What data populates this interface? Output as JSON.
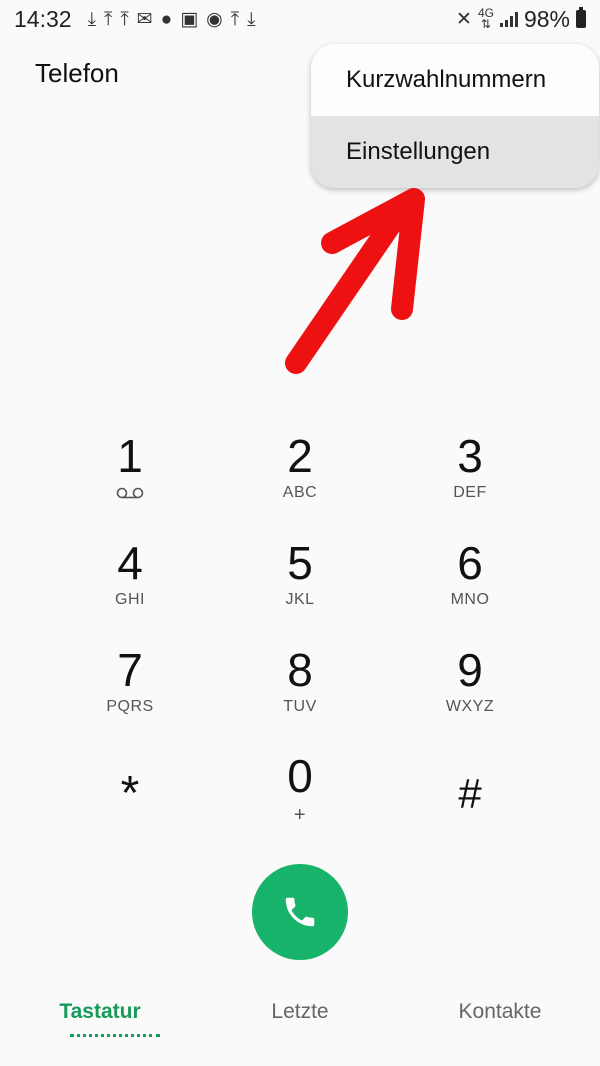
{
  "status_bar": {
    "time": "14:32",
    "network": "4G",
    "battery": "98%"
  },
  "header": {
    "title": "Telefon"
  },
  "menu": {
    "items": [
      {
        "label": "Kurzwahlnummern"
      },
      {
        "label": "Einstellungen"
      }
    ]
  },
  "keypad": {
    "keys": [
      {
        "digit": "1",
        "letters": ""
      },
      {
        "digit": "2",
        "letters": "ABC"
      },
      {
        "digit": "3",
        "letters": "DEF"
      },
      {
        "digit": "4",
        "letters": "GHI"
      },
      {
        "digit": "5",
        "letters": "JKL"
      },
      {
        "digit": "6",
        "letters": "MNO"
      },
      {
        "digit": "7",
        "letters": "PQRS"
      },
      {
        "digit": "8",
        "letters": "TUV"
      },
      {
        "digit": "9",
        "letters": "WXYZ"
      },
      {
        "digit": "*",
        "letters": ""
      },
      {
        "digit": "0",
        "letters": "+"
      },
      {
        "digit": "#",
        "letters": ""
      }
    ]
  },
  "tabs": [
    {
      "label": "Tastatur"
    },
    {
      "label": "Letzte"
    },
    {
      "label": "Kontakte"
    }
  ],
  "colors": {
    "accent": "#18b36a",
    "annotation": "#ee1111"
  }
}
